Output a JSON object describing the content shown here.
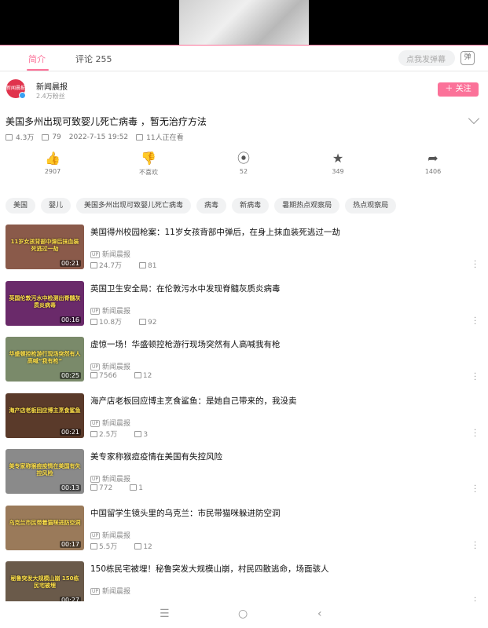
{
  "player": {
    "progress_percent": 100,
    "accent": "#fb7299"
  },
  "tabs": [
    {
      "label": "简介"
    },
    {
      "label": "评论 255"
    }
  ],
  "danmaku": {
    "placeholder": "点我发弹幕",
    "toggle_label": "弹"
  },
  "uploader": {
    "name": "新闻晨报",
    "fans": "2.4万粉丝",
    "avatar_text": "新闻晨报"
  },
  "follow_label": "＋ 关注",
  "video": {
    "title": "美国多州出现可致婴儿死亡病毒 ，暂无治疗方法",
    "views": "4.3万",
    "danmaku_count": "79",
    "datetime": "2022-7-15 19:52",
    "watching": "11人正在看"
  },
  "actions": [
    {
      "icon": "thumb-up-icon",
      "glyph": "👍",
      "value": "2907"
    },
    {
      "icon": "thumb-down-icon",
      "glyph": "👎",
      "value": "不喜欢"
    },
    {
      "icon": "coin-icon",
      "glyph": "⦿",
      "value": "52"
    },
    {
      "icon": "star-icon",
      "glyph": "★",
      "value": "349"
    },
    {
      "icon": "share-icon",
      "glyph": "➦",
      "value": "1406"
    }
  ],
  "tags": [
    "美国",
    "婴儿",
    "美国多州出现可致婴儿死亡病毒",
    "病毒",
    "新病毒",
    "暑期热点观察局",
    "热点观察局"
  ],
  "recommendations": [
    {
      "title": "美国得州校园枪案：11岁女孩背部中弹后，在身上抹血装死逃过一劫",
      "uploader": "新闻晨报",
      "views": "24.7万",
      "comments": "81",
      "duration": "00:21",
      "thumb_text": "11岁女孩背部中弹后抹血装死逃过一劫",
      "thumb_color": "#8a5a4a"
    },
    {
      "title": "英国卫生安全局：在伦敦污水中发现脊髓灰质炎病毒",
      "uploader": "新闻晨报",
      "views": "10.8万",
      "comments": "92",
      "duration": "00:16",
      "thumb_text": "英国伦敦污水中检测出脊髓灰质炎病毒",
      "thumb_color": "#6a2a6a"
    },
    {
      "title": "虚惊一场！华盛顿控枪游行现场突然有人高喊我有枪",
      "uploader": "新闻晨报",
      "views": "7566",
      "comments": "12",
      "duration": "00:25",
      "thumb_text": "华盛顿控枪游行现场突然有人高喊“我有枪”",
      "thumb_color": "#7a8a6a"
    },
    {
      "title": "海产店老板回应博主烹食鲨鱼：是她自己带来的，我没卖",
      "uploader": "新闻晨报",
      "views": "2.5万",
      "comments": "3",
      "duration": "00:21",
      "thumb_text": "海产店老板回应博主烹食鲨鱼",
      "thumb_color": "#5a3a2a"
    },
    {
      "title": "美专家称猴痘疫情在美国有失控风险",
      "uploader": "新闻晨报",
      "views": "772",
      "comments": "1",
      "duration": "00:13",
      "thumb_text": "美专家称猴痘疫情在美国有失控风险",
      "thumb_color": "#8a8a8a"
    },
    {
      "title": "中国留学生镜头里的乌克兰：市民带猫咪躲进防空洞",
      "uploader": "新闻晨报",
      "views": "5.5万",
      "comments": "12",
      "duration": "00:17",
      "thumb_text": "乌克兰市民带着猫咪进防空洞",
      "thumb_color": "#9a7a5a"
    },
    {
      "title": "150栋民宅被埋！秘鲁突发大规模山崩，村民四散逃命，场面骇人",
      "uploader": "新闻晨报",
      "views": "",
      "comments": "",
      "duration": "00:27",
      "thumb_text": "秘鲁突发大规模山崩 150栋民宅被埋",
      "thumb_color": "#6a5a4a"
    }
  ],
  "nav": {
    "menu": "☰",
    "home": "○",
    "back": "‹"
  }
}
